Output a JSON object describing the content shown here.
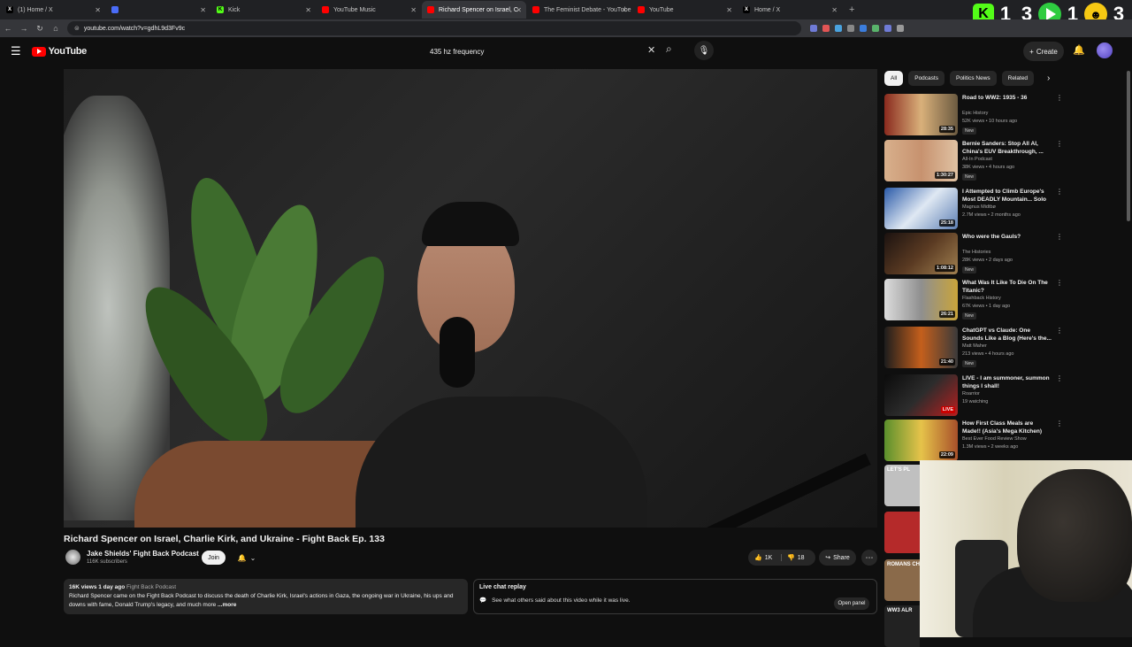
{
  "browser": {
    "tabs": [
      {
        "title": "(1) Home / X",
        "fav": "X",
        "fav_color": "#000000",
        "fav_fg": "#ffffff"
      },
      {
        "title": "",
        "fav": "",
        "fav_color": "#4a6cf7",
        "fav_fg": "#ffffff"
      },
      {
        "title": "Kick",
        "fav": "K",
        "fav_color": "#53fc18",
        "fav_fg": "#000000"
      },
      {
        "title": "YouTube Music",
        "fav": "",
        "fav_color": "#ff0000",
        "fav_fg": "#ffffff"
      },
      {
        "title": "Richard Spencer on Israel, C",
        "fav": "",
        "fav_color": "#ff0000",
        "fav_fg": "#ffffff"
      },
      {
        "title": "The Feminist Debate - YouTube",
        "fav": "",
        "fav_color": "#ff0000",
        "fav_fg": "#ffffff"
      },
      {
        "title": "YouTube",
        "fav": "",
        "fav_color": "#ff0000",
        "fav_fg": "#ffffff"
      },
      {
        "title": "Home / X",
        "fav": "X",
        "fav_color": "#000000",
        "fav_fg": "#ffffff"
      }
    ],
    "active_tab": 4,
    "url": "youtube.com/watch?v=gdhL9d3Fv9c",
    "overlay": {
      "n1": "1",
      "n2": "3",
      "n3": "1",
      "n4": "3"
    }
  },
  "header": {
    "logo": "YouTube",
    "search_value": "435 hz frequency",
    "create_label": "Create"
  },
  "video": {
    "title": "Richard Spencer on Israel, Charlie Kirk, and Ukraine - Fight Back Ep. 133",
    "channel": "Jake Shields' Fight Back Podcast",
    "subscribers": "116K subscribers",
    "join_label": "Join",
    "likes": "1K",
    "dislikes": "18",
    "share_label": "Share"
  },
  "description": {
    "meta": "16K views  1 day ago",
    "hashtag": "Fight Back Podcast",
    "text": "Richard Spencer came on the Fight Back Podcast to discuss the death of Charlie Kirk, Israel's actions in Gaza, the ongoing war in Ukraine, his ups and downs with fame, Donald Trump's legacy, and much more",
    "more": "...more"
  },
  "live_chat": {
    "title": "Live chat replay",
    "text": "See what others said about this video while it was live.",
    "button": "Open panel"
  },
  "chips": [
    "All",
    "Podcasts",
    "Politics News",
    "Related"
  ],
  "recommendations": [
    {
      "title": "Road to WW2: 1935 - 36",
      "channel": "Epic History",
      "meta": "52K views • 10 hours ago",
      "duration": "28:35",
      "new": "New",
      "thumb": "linear-gradient(90deg,#8a2a1e,#d9b07a,#6b5a40)"
    },
    {
      "title": "Bernie Sanders: Stop All AI, China's EUV Breakthrough, ...",
      "channel": "All-In Podcast",
      "meta": "38K views • 4 hours ago",
      "duration": "1:30:27",
      "new": "New",
      "thumb": "linear-gradient(90deg,#d8b08c,#c7926f,#e0c2a3)"
    },
    {
      "title": "I Attempted to Climb Europe's Most DEADLY Mountain... Solo",
      "channel": "Magnus Midtbø",
      "meta": "2.7M views • 2 months ago",
      "duration": "25:18",
      "new": "",
      "thumb": "linear-gradient(135deg,#2a5aa8,#dfe8f3,#5d7fb3)"
    },
    {
      "title": "Who were the Gauls?",
      "channel": "The Histories",
      "meta": "28K views • 2 days ago",
      "duration": "1:08:12",
      "new": "New",
      "thumb": "linear-gradient(135deg,#1b1210,#5a3a22,#a08050)"
    },
    {
      "title": "What Was It Like To Die On The Titanic?",
      "channel": "Flashback History",
      "meta": "67K views • 1 day ago",
      "duration": "26:21",
      "new": "New",
      "thumb": "linear-gradient(90deg,#dcdcdc,#8f8f8f,#c9a43b)"
    },
    {
      "title": "ChatGPT vs Claude: One Sounds Like a Blog (Here's the...",
      "channel": "Matt Maher",
      "meta": "213 views • 4 hours ago",
      "duration": "21:40",
      "new": "New",
      "thumb": "linear-gradient(90deg,#1d1d1d,#c45f1c,#3a3a3a)"
    },
    {
      "title": "LIVE - I am summoner, summon things I shall!",
      "channel": "Roarrior",
      "meta": "19 watching",
      "duration": "LIVE",
      "new": "",
      "thumb": "linear-gradient(135deg,#0b0b0b,#2c2c2c,#b81f1f)"
    },
    {
      "title": "How First Class Meals are Made!! (Asia's Mega Kitchen)",
      "channel": "Best Ever Food Review Show",
      "meta": "1.3M views • 2 weeks ago",
      "duration": "22:09",
      "new": "",
      "thumb": "linear-gradient(90deg,#5a8f2c,#e6c34a,#a8502a)"
    }
  ],
  "partial_thumbs": [
    "LET'S PL",
    "",
    "ROMANS CHAN",
    "WW3 ALR"
  ]
}
